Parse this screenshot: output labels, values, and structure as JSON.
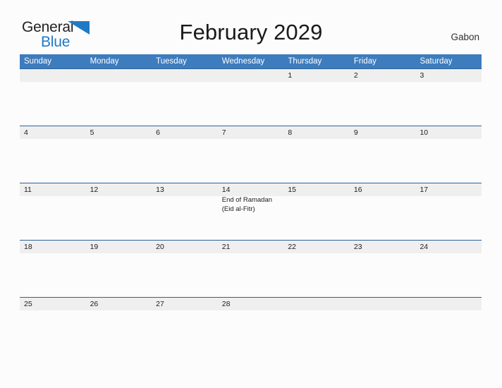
{
  "brand": {
    "name_part1": "General",
    "name_part2": "Blue",
    "flag_icon": "blue-triangle-flag-icon",
    "accent_color": "#1f7ac4"
  },
  "header": {
    "title": "February 2029",
    "country": "Gabon"
  },
  "calendar": {
    "header_bg_color": "#3d7cbd",
    "row_band_color": "#efefef",
    "row_border_color": "#2c6299",
    "weekdays": [
      "Sunday",
      "Monday",
      "Tuesday",
      "Wednesday",
      "Thursday",
      "Friday",
      "Saturday"
    ],
    "weeks": [
      [
        {
          "day": "",
          "events": []
        },
        {
          "day": "",
          "events": []
        },
        {
          "day": "",
          "events": []
        },
        {
          "day": "",
          "events": []
        },
        {
          "day": "1",
          "events": []
        },
        {
          "day": "2",
          "events": []
        },
        {
          "day": "3",
          "events": []
        }
      ],
      [
        {
          "day": "4",
          "events": []
        },
        {
          "day": "5",
          "events": []
        },
        {
          "day": "6",
          "events": []
        },
        {
          "day": "7",
          "events": []
        },
        {
          "day": "8",
          "events": []
        },
        {
          "day": "9",
          "events": []
        },
        {
          "day": "10",
          "events": []
        }
      ],
      [
        {
          "day": "11",
          "events": []
        },
        {
          "day": "12",
          "events": []
        },
        {
          "day": "13",
          "events": []
        },
        {
          "day": "14",
          "events": [
            "End of Ramadan",
            "(Eid al-Fitr)"
          ]
        },
        {
          "day": "15",
          "events": []
        },
        {
          "day": "16",
          "events": []
        },
        {
          "day": "17",
          "events": []
        }
      ],
      [
        {
          "day": "18",
          "events": []
        },
        {
          "day": "19",
          "events": []
        },
        {
          "day": "20",
          "events": []
        },
        {
          "day": "21",
          "events": []
        },
        {
          "day": "22",
          "events": []
        },
        {
          "day": "23",
          "events": []
        },
        {
          "day": "24",
          "events": []
        }
      ],
      [
        {
          "day": "25",
          "events": []
        },
        {
          "day": "26",
          "events": []
        },
        {
          "day": "27",
          "events": []
        },
        {
          "day": "28",
          "events": []
        },
        {
          "day": "",
          "events": []
        },
        {
          "day": "",
          "events": []
        },
        {
          "day": "",
          "events": []
        }
      ]
    ]
  }
}
